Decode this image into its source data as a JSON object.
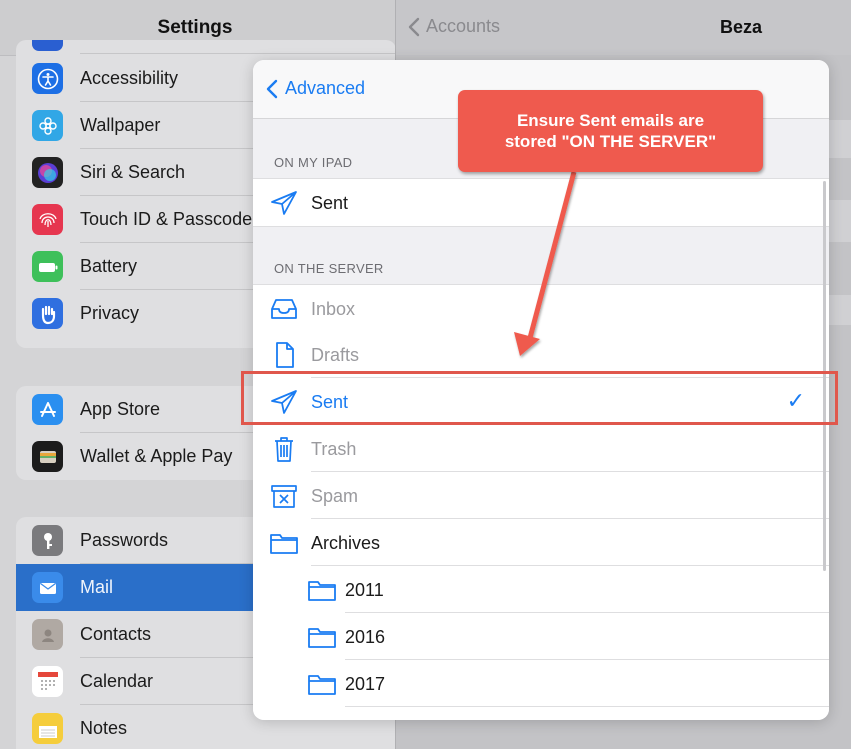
{
  "settings": {
    "title": "Settings",
    "group1": [
      {
        "label": "Accessibility",
        "icon": "accessibility-icon",
        "color": "#1d6fe5"
      },
      {
        "label": "Wallpaper",
        "icon": "wallpaper-icon",
        "color": "#31a7e6"
      },
      {
        "label": "Siri & Search",
        "icon": "siri-icon",
        "color": "#222222"
      },
      {
        "label": "Touch ID & Passcode",
        "icon": "fingerprint-icon",
        "color": "#e6364f"
      },
      {
        "label": "Battery",
        "icon": "battery-icon",
        "color": "#3ec05a"
      },
      {
        "label": "Privacy",
        "icon": "hand-icon",
        "color": "#2f6fe0"
      }
    ],
    "group2": [
      {
        "label": "App Store",
        "icon": "app-store-icon",
        "color": "#2a8ff0"
      },
      {
        "label": "Wallet & Apple Pay",
        "icon": "wallet-icon",
        "color": "#1c1c1c"
      }
    ],
    "group3": [
      {
        "label": "Passwords",
        "icon": "key-icon",
        "color": "#7a7a7d"
      },
      {
        "label": "Mail",
        "icon": "mail-icon",
        "color": "#3a8bea",
        "selected": true
      },
      {
        "label": "Contacts",
        "icon": "contacts-icon",
        "color": "#b0a9a3"
      },
      {
        "label": "Calendar",
        "icon": "calendar-icon",
        "color": "#ffffff"
      },
      {
        "label": "Notes",
        "icon": "notes-icon",
        "color": "#f5cd3c"
      }
    ]
  },
  "detail": {
    "back_label": "Accounts",
    "title": "Beza"
  },
  "sheet": {
    "back_label": "Advanced",
    "section_ipad": "ON MY IPAD",
    "ipad_sent": "Sent",
    "section_server": "ON THE SERVER",
    "server": {
      "inbox": "Inbox",
      "drafts": "Drafts",
      "sent": "Sent",
      "trash": "Trash",
      "spam": "Spam",
      "archives": "Archives",
      "y2011": "2011",
      "y2016": "2016",
      "y2017": "2017"
    },
    "checkmark": "✓"
  },
  "annotation": {
    "callout_line1": "Ensure Sent emails are",
    "callout_line2": "stored \"ON THE SERVER\"",
    "accent": "#ef5a4e"
  }
}
